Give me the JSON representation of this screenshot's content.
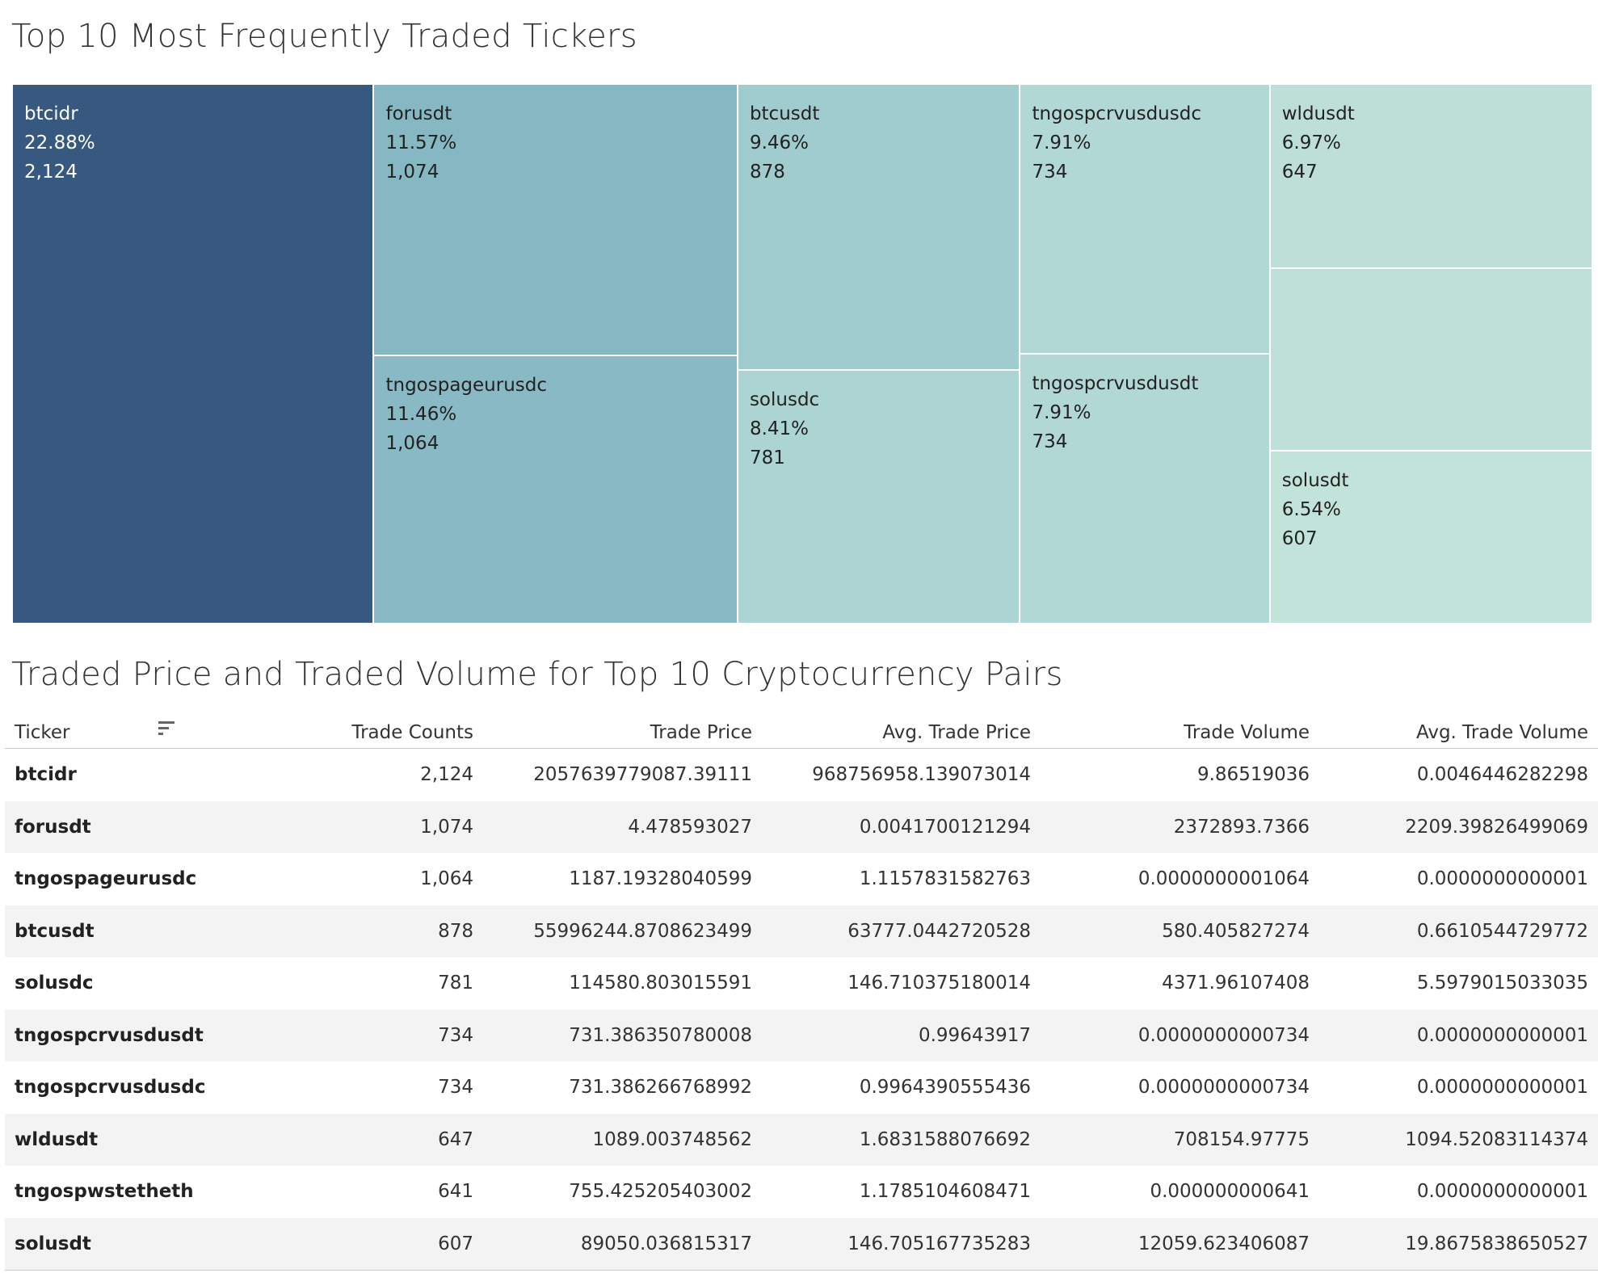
{
  "chart_data": [
    {
      "type": "treemap",
      "title": "Top 10 Most Frequently Traded Tickers",
      "items": [
        {
          "ticker": "btcidr",
          "percent": "22.88%",
          "count": "2,124",
          "value": 2124,
          "color": "#37587f",
          "text_color": "#ffffff"
        },
        {
          "ticker": "forusdt",
          "percent": "11.57%",
          "count": "1,074",
          "value": 1074,
          "color": "#86b8c4",
          "text_color": "#222222"
        },
        {
          "ticker": "tngospageurusdc",
          "percent": "11.46%",
          "count": "1,064",
          "value": 1064,
          "color": "#88b9c5",
          "text_color": "#222222"
        },
        {
          "ticker": "btcusdt",
          "percent": "9.46%",
          "count": "878",
          "value": 878,
          "color": "#a0cbcf",
          "text_color": "#222222"
        },
        {
          "ticker": "solusdc",
          "percent": "8.41%",
          "count": "781",
          "value": 781,
          "color": "#acd4d3",
          "text_color": "#222222"
        },
        {
          "ticker": "tngospcrvusdusdc",
          "percent": "7.91%",
          "count": "734",
          "value": 734,
          "color": "#b1d8d5",
          "text_color": "#222222"
        },
        {
          "ticker": "tngospcrvusdusdt",
          "percent": "7.91%",
          "count": "734",
          "value": 734,
          "color": "#b1d8d5",
          "text_color": "#222222"
        },
        {
          "ticker": "wldusdt",
          "percent": "6.97%",
          "count": "647",
          "value": 647,
          "color": "#bddfd8",
          "text_color": "#222222"
        },
        {
          "ticker": "tngospwstetheth",
          "percent": "",
          "count": "",
          "value": 641,
          "color": "#bee0d9",
          "text_color": "#222222"
        },
        {
          "ticker": "solusdt",
          "percent": "6.54%",
          "count": "607",
          "value": 607,
          "color": "#c2e3d9",
          "text_color": "#222222"
        }
      ]
    },
    {
      "type": "table",
      "title": "Traded Price and Traded Volume for Top 10 Cryptocurrency Pairs",
      "columns": [
        "Ticker",
        "Trade Counts",
        "Trade Price",
        "Avg. Trade Price",
        "Trade Volume",
        "Avg. Trade Volume"
      ],
      "rows": [
        [
          "btcidr",
          "2,124",
          "2057639779087.39111",
          "968756958.139073014",
          "9.86519036",
          "0.0046446282298"
        ],
        [
          "forusdt",
          "1,074",
          "4.478593027",
          "0.0041700121294",
          "2372893.7366",
          "2209.39826499069"
        ],
        [
          "tngospageurusdc",
          "1,064",
          "1187.19328040599",
          "1.1157831582763",
          "0.0000000001064",
          "0.0000000000001"
        ],
        [
          "btcusdt",
          "878",
          "55996244.8708623499",
          "63777.0442720528",
          "580.405827274",
          "0.6610544729772"
        ],
        [
          "solusdc",
          "781",
          "114580.803015591",
          "146.710375180014",
          "4371.96107408",
          "5.5979015033035"
        ],
        [
          "tngospcrvusdusdt",
          "734",
          "731.386350780008",
          "0.99643917",
          "0.0000000000734",
          "0.0000000000001"
        ],
        [
          "tngospcrvusdusdc",
          "734",
          "731.386266768992",
          "0.9964390555436",
          "0.0000000000734",
          "0.0000000000001"
        ],
        [
          "wldusdt",
          "647",
          "1089.003748562",
          "1.6831588076692",
          "708154.97775",
          "1094.52083114374"
        ],
        [
          "tngospwstetheth",
          "641",
          "755.425205403002",
          "1.1785104608471",
          "0.000000000641",
          "0.0000000000001"
        ],
        [
          "solusdt",
          "607",
          "89050.036815317",
          "146.705167735283",
          "12059.623406087",
          "19.8675838650527"
        ]
      ]
    }
  ]
}
